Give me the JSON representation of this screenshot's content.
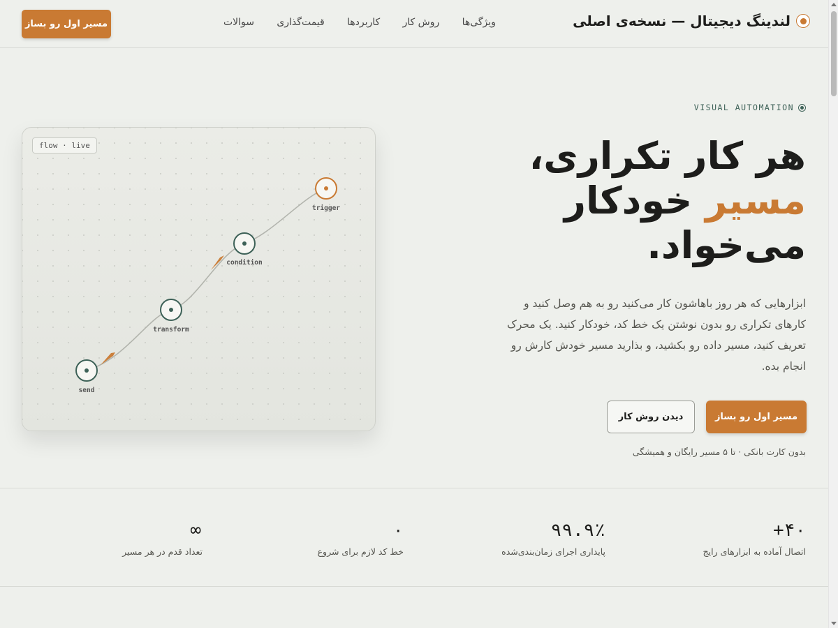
{
  "header": {
    "brand": "لندینگ دیجیتال — نسخه‌ی اصلی",
    "nav": [
      "ویژگی‌ها",
      "روش کار",
      "کاربردها",
      "قیمت‌گذاری",
      "سوالات"
    ],
    "cta": "مسیر اول رو بساز"
  },
  "hero": {
    "eyebrow": "VISUAL AUTOMATION",
    "headline_line1": "هر کار تکراری،",
    "headline_accent": "مسیر",
    "headline_line2_rest": " خودکار",
    "headline_line3": "می‌خواد.",
    "lead": "ابزارهایی که هر روز باهاشون کار می‌کنید رو به هم وصل کنید و کارهای تکراری رو بدون نوشتن یک خط کد، خودکار کنید. یک محرک تعریف کنید، مسیر داده رو بکشید، و بذارید مسیر خودش کارش رو انجام بده.",
    "primary_button": "مسیر اول رو بساز",
    "secondary_button": "دیدن روش کار",
    "note": "بدون کارت بانکی · تا ۵ مسیر رایگان و همیشگی"
  },
  "flow": {
    "tag": "flow · live",
    "nodes": {
      "trigger": "trigger",
      "condition": "condition",
      "transform": "transform",
      "send": "send"
    }
  },
  "stats": [
    {
      "value": "۴۰+",
      "label": "اتصال آماده به ابزارهای رایج"
    },
    {
      "value": "۹۹.۹٪",
      "label": "پایداری اجرای زمان‌بندی‌شده"
    },
    {
      "value": "۰",
      "label": "خط کد لازم برای شروع"
    },
    {
      "value": "∞",
      "label": "تعداد قدم در هر مسیر"
    }
  ],
  "colors": {
    "accent": "#c97a33",
    "node": "#3d6157",
    "background": "#eef0ec"
  }
}
